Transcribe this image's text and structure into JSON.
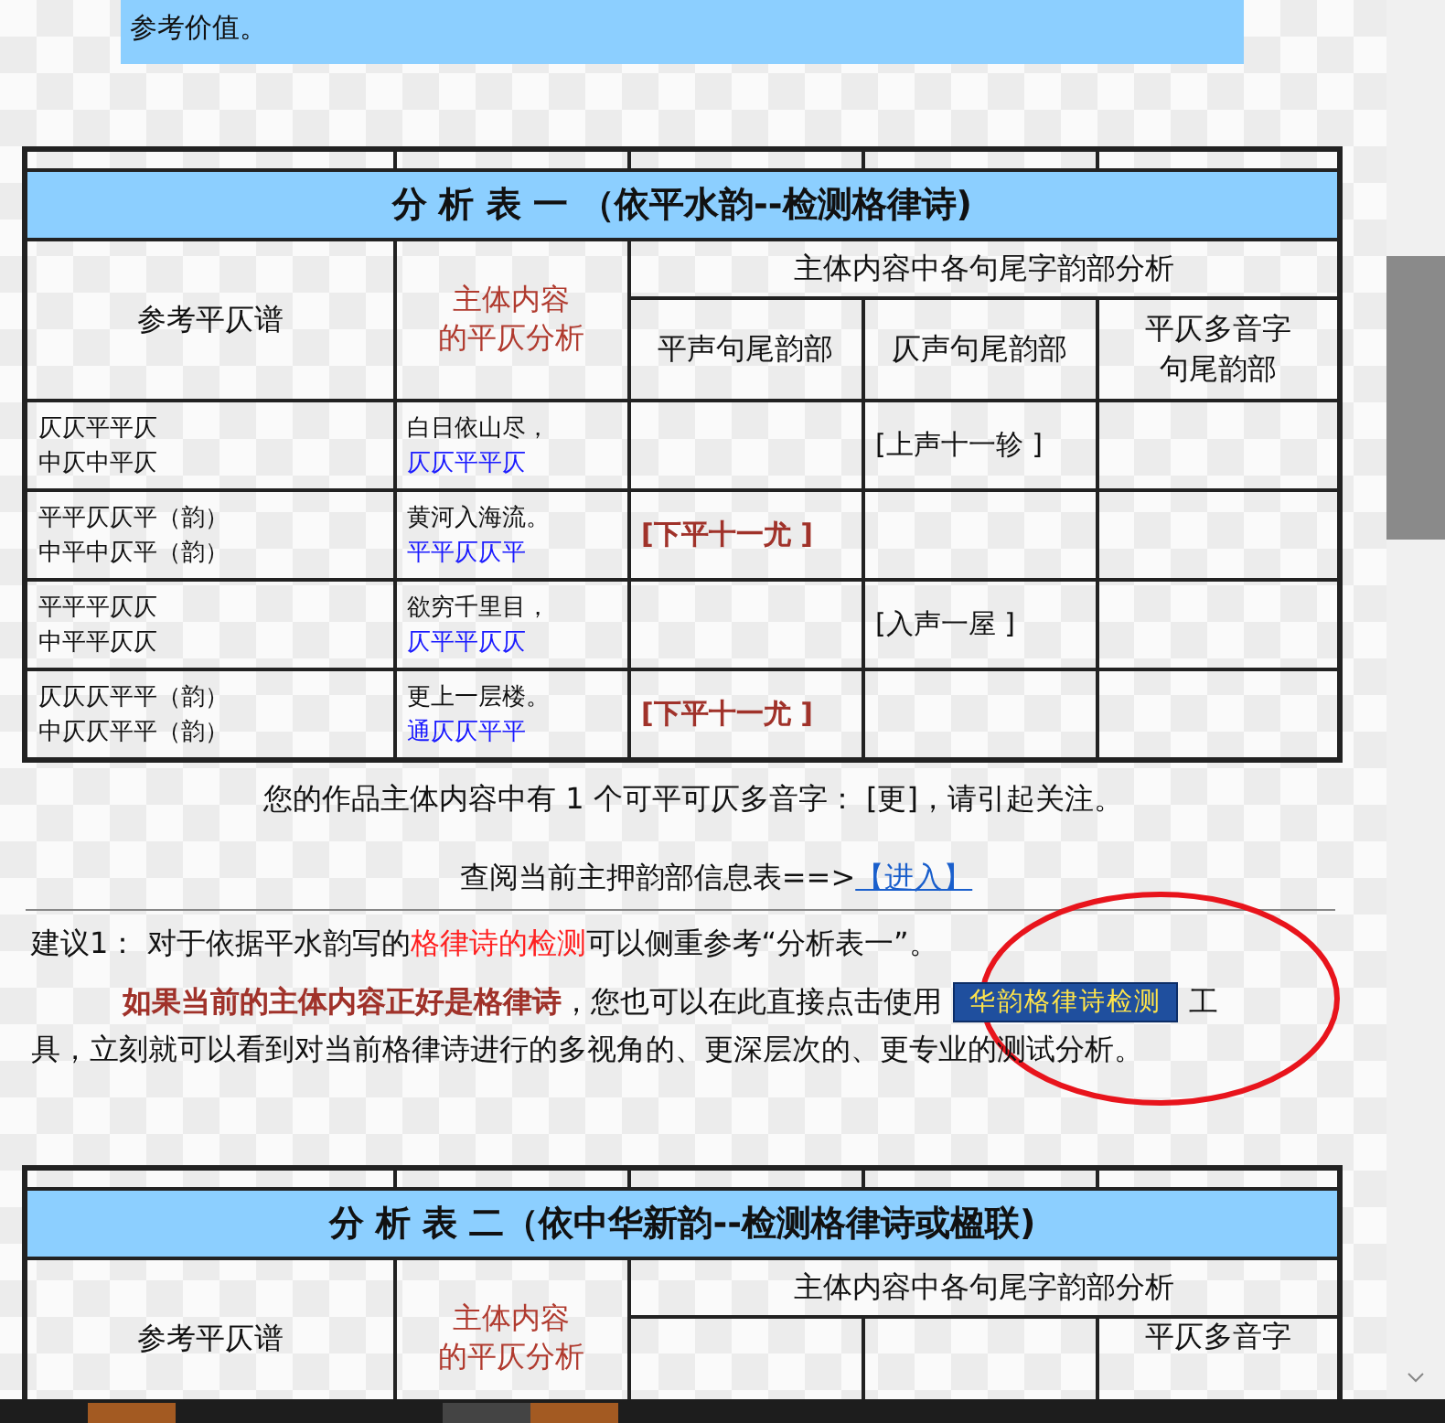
{
  "intro": {
    "text": "参考价值。"
  },
  "table1": {
    "title": "分 析 表 一 （依平水韵--检测格律诗)",
    "col_pattern": "参考平仄谱",
    "col_content": [
      "主体内容",
      "的平仄分析"
    ],
    "group": "主体内容中各句尾字韵部分析",
    "sub_headers": [
      [
        "平声句尾韵部"
      ],
      [
        "仄声句尾韵部"
      ],
      [
        "平仄多音字",
        "句尾韵部"
      ]
    ],
    "rows": [
      {
        "pattern": [
          "仄仄平平仄",
          "中仄中平仄"
        ],
        "line": "白日依山尽，",
        "tones": "仄仄平平仄",
        "ping": null,
        "ze": "[上声十一轸 ]"
      },
      {
        "pattern": [
          "平平仄仄平（韵）",
          "中平中仄平（韵）"
        ],
        "line": "黄河入海流。",
        "tones": "平平仄仄平",
        "ping": "[下平十一尤 ]",
        "ze": null
      },
      {
        "pattern": [
          "平平平仄仄",
          "中平平仄仄"
        ],
        "line": "欲穷千里目，",
        "tones": "仄平平仄仄",
        "ping": null,
        "ze": "[入声一屋 ]"
      },
      {
        "pattern": [
          "仄仄仄平平（韵）",
          "中仄仄平平（韵）"
        ],
        "line": "更上一层楼。",
        "tones": "通仄仄平平",
        "ping": "[下平十一尤 ]",
        "ze": null
      }
    ]
  },
  "notice": "您的作品主体内容中有 1 个可平可仄多音字： [更]，请引起关注。",
  "lookup": {
    "prompt": "查阅当前主押韵部信息表==>",
    "link": "【进入】"
  },
  "suggestion": [
    {
      "kind": "text",
      "text": "建议1：  对于依据平水韵写的"
    },
    {
      "kind": "highlight",
      "text": "格律诗的检测"
    },
    {
      "kind": "text",
      "text": "可以侧重参考“分析表一”。"
    }
  ],
  "paragraph": [
    {
      "kind": "emphasis",
      "text": "如果当前的主体内容正好是格律诗"
    },
    {
      "kind": "text",
      "text": "，您也可以在此直接点击使用 "
    },
    {
      "kind": "button",
      "text": "华韵格律诗检测"
    },
    {
      "kind": "text",
      "text": "工"
    },
    {
      "kind": "line",
      "text": "具，立刻就可以看到对当前格律诗进行的多视角的、更深层次的、更专业的测试分析。"
    }
  ],
  "table2": {
    "title": "分 析 表 二（依中华新韵--检测格律诗或楹联)",
    "col_pattern": "参考平仄谱",
    "col_content": [
      "主体内容",
      "的平仄分析"
    ],
    "group": "主体内容中各句尾字韵部分析",
    "sub_headers": [
      [
        "平仄多音字"
      ]
    ]
  }
}
